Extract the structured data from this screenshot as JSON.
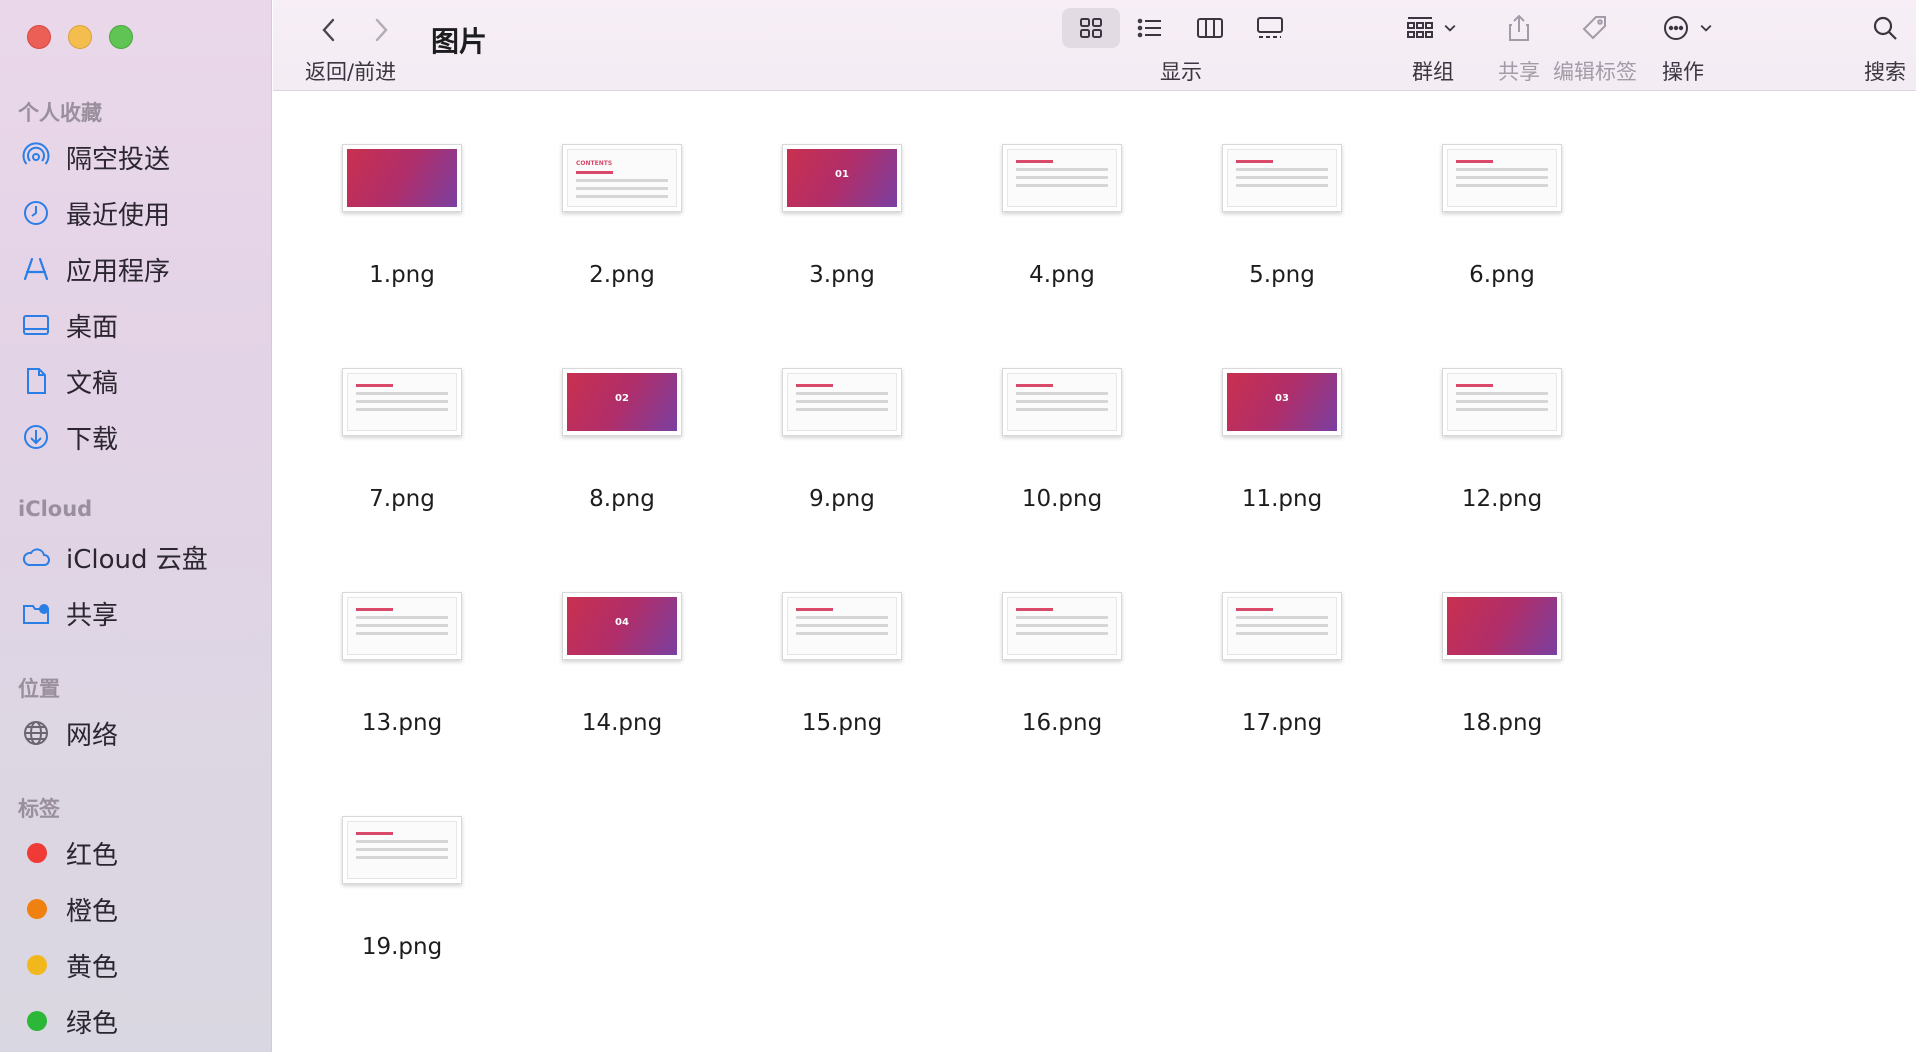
{
  "window": {
    "title": "图片"
  },
  "toolbar": {
    "nav_label": "返回/前进",
    "view_label": "显示",
    "group_label": "群组",
    "share_label": "共享",
    "tags_label": "编辑标签",
    "action_label": "操作",
    "search_label": "搜索"
  },
  "sidebar": {
    "favorites_header": "个人收藏",
    "favorites": [
      {
        "label": "隔空投送",
        "icon": "airdrop-icon"
      },
      {
        "label": "最近使用",
        "icon": "clock-icon"
      },
      {
        "label": "应用程序",
        "icon": "applications-icon"
      },
      {
        "label": "桌面",
        "icon": "desktop-icon"
      },
      {
        "label": "文稿",
        "icon": "document-icon"
      },
      {
        "label": "下载",
        "icon": "download-icon"
      }
    ],
    "icloud_header": "iCloud",
    "icloud": [
      {
        "label": "iCloud 云盘",
        "icon": "cloud-icon"
      },
      {
        "label": "共享",
        "icon": "shared-folder-icon"
      }
    ],
    "locations_header": "位置",
    "locations": [
      {
        "label": "网络",
        "icon": "globe-icon"
      }
    ],
    "tags_header": "标签",
    "tags": [
      {
        "label": "红色",
        "color": "#f03a36"
      },
      {
        "label": "橙色",
        "color": "#f0800f"
      },
      {
        "label": "黄色",
        "color": "#f2b81b"
      },
      {
        "label": "绿色",
        "color": "#2bb738"
      }
    ]
  },
  "files": [
    {
      "name": "1.png",
      "style": "grad",
      "caption": ""
    },
    {
      "name": "2.png",
      "style": "white",
      "caption": "CONTENTS"
    },
    {
      "name": "3.png",
      "style": "grad",
      "caption": "01"
    },
    {
      "name": "4.png",
      "style": "white",
      "caption": ""
    },
    {
      "name": "5.png",
      "style": "white",
      "caption": ""
    },
    {
      "name": "6.png",
      "style": "white",
      "caption": ""
    },
    {
      "name": "7.png",
      "style": "white",
      "caption": ""
    },
    {
      "name": "8.png",
      "style": "grad",
      "caption": "02"
    },
    {
      "name": "9.png",
      "style": "white",
      "caption": ""
    },
    {
      "name": "10.png",
      "style": "white",
      "caption": ""
    },
    {
      "name": "11.png",
      "style": "grad",
      "caption": "03"
    },
    {
      "name": "12.png",
      "style": "white",
      "caption": ""
    },
    {
      "name": "13.png",
      "style": "white",
      "caption": ""
    },
    {
      "name": "14.png",
      "style": "grad",
      "caption": "04"
    },
    {
      "name": "15.png",
      "style": "white",
      "caption": ""
    },
    {
      "name": "16.png",
      "style": "white",
      "caption": ""
    },
    {
      "name": "17.png",
      "style": "white",
      "caption": ""
    },
    {
      "name": "18.png",
      "style": "grad",
      "caption": ""
    },
    {
      "name": "19.png",
      "style": "white",
      "caption": ""
    }
  ]
}
